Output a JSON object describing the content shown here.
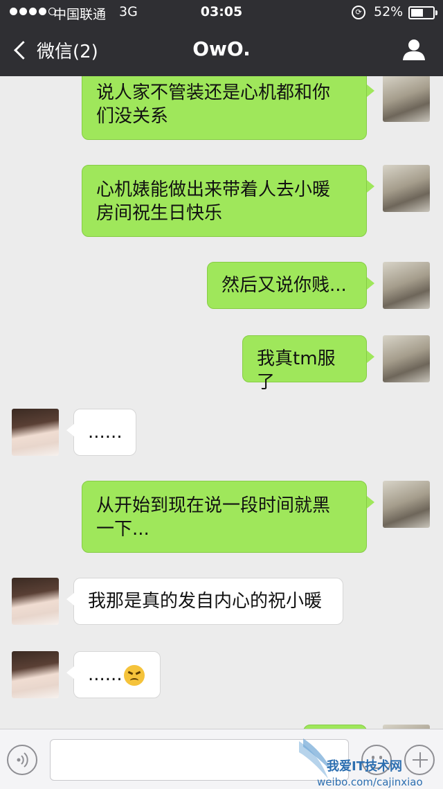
{
  "status_bar": {
    "carrier": "中国联通",
    "network": "3G",
    "time": "03:05",
    "battery": "52%",
    "battery_level": 0.52
  },
  "nav": {
    "back_label": "微信(2)",
    "title": "OwO."
  },
  "messages": [
    {
      "side": "right",
      "lines": [
        "说人家不管装还是心机都和你",
        "们没关系"
      ]
    },
    {
      "side": "right",
      "lines": [
        "心机婊能做出来带着人去小暖",
        "房间祝生日快乐"
      ]
    },
    {
      "side": "right",
      "lines": [
        "然后又说你贱..."
      ]
    },
    {
      "side": "right",
      "lines": [
        "我真tm服了"
      ]
    },
    {
      "side": "left",
      "lines": [
        "......"
      ]
    },
    {
      "side": "right",
      "lines": [
        "从开始到现在说一段时间就黑",
        "一下..."
      ]
    },
    {
      "side": "left",
      "lines": [
        "我那是真的发自内心的祝小暖"
      ]
    },
    {
      "side": "left",
      "lines": [
        "......"
      ],
      "emoji": "angry-face-icon"
    }
  ],
  "input_bar": {
    "voice_icon": "voice-icon",
    "emoji_icon": "smiley-icon",
    "plus_icon": "plus-icon",
    "placeholder": ""
  },
  "watermark": {
    "line1": "我爱IT技术网",
    "line2": "weibo.com/cajinxiao"
  },
  "colors": {
    "nav_bg": "#2f2f33",
    "sent_bubble": "#9fe75b",
    "received_bubble": "#ffffff",
    "chat_bg": "#ececec"
  }
}
